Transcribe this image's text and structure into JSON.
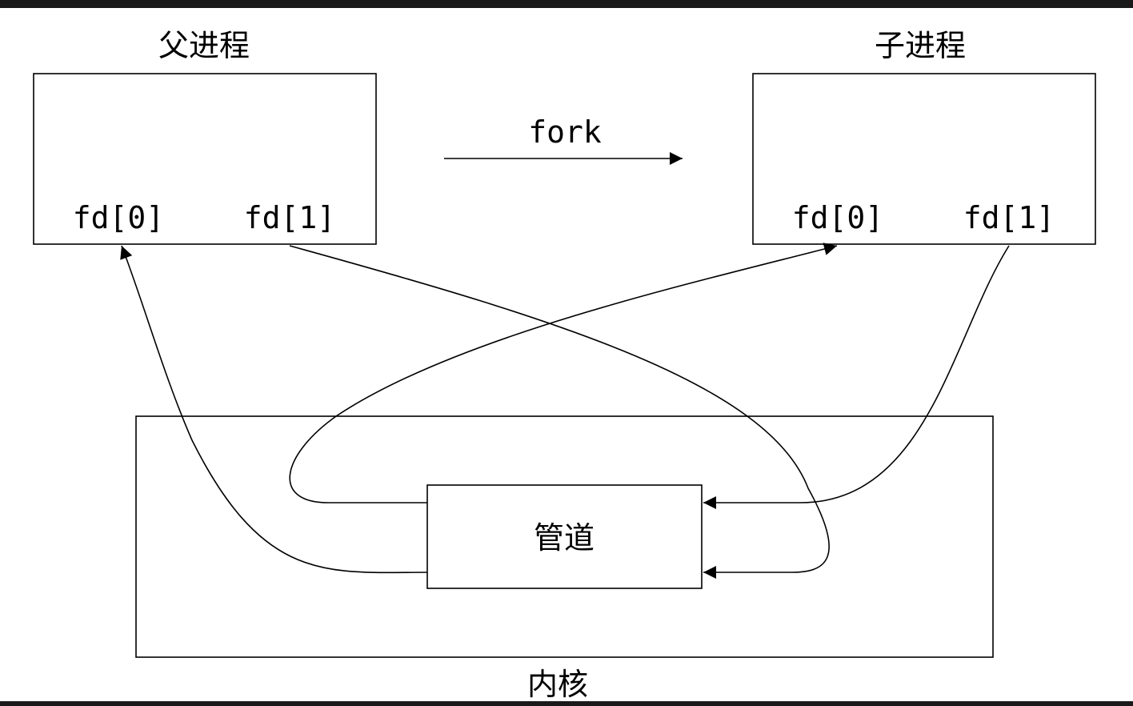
{
  "parent": {
    "title": "父进程",
    "fd0": "fd[0]",
    "fd1": "fd[1]"
  },
  "child": {
    "title": "子进程",
    "fd0": "fd[0]",
    "fd1": "fd[1]"
  },
  "fork_label": "fork",
  "pipe_label": "管道",
  "kernel_label": "内核"
}
